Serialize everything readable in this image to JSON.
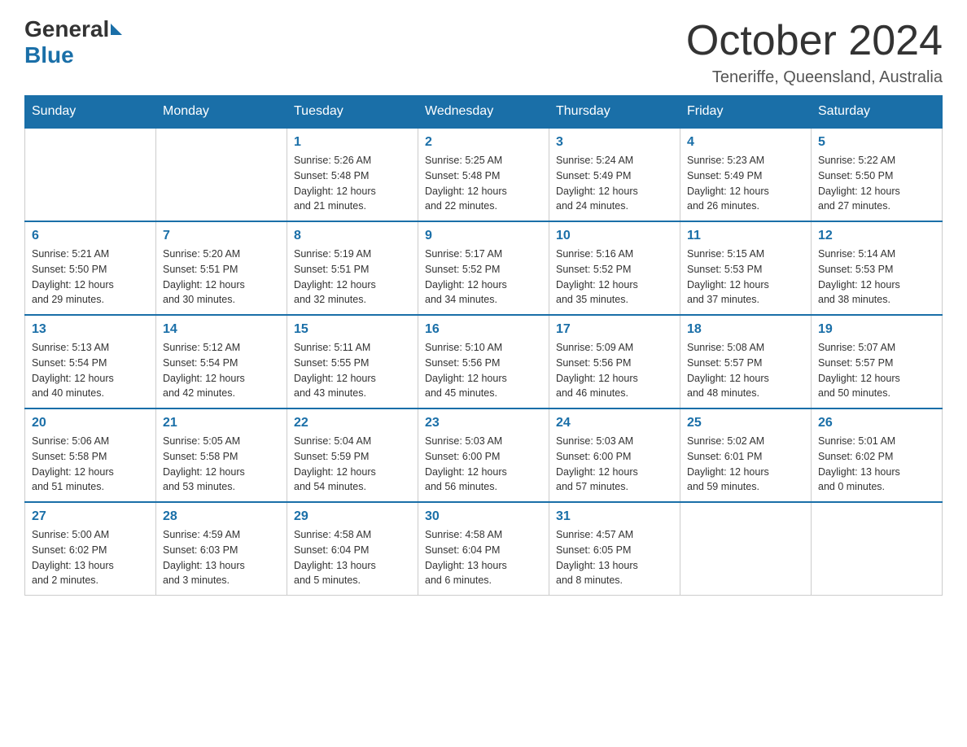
{
  "header": {
    "logo": {
      "general": "General",
      "blue": "Blue"
    },
    "title": "October 2024",
    "location": "Teneriffe, Queensland, Australia"
  },
  "days_of_week": [
    "Sunday",
    "Monday",
    "Tuesday",
    "Wednesday",
    "Thursday",
    "Friday",
    "Saturday"
  ],
  "weeks": [
    [
      {
        "day": "",
        "info": ""
      },
      {
        "day": "",
        "info": ""
      },
      {
        "day": "1",
        "info": "Sunrise: 5:26 AM\nSunset: 5:48 PM\nDaylight: 12 hours\nand 21 minutes."
      },
      {
        "day": "2",
        "info": "Sunrise: 5:25 AM\nSunset: 5:48 PM\nDaylight: 12 hours\nand 22 minutes."
      },
      {
        "day": "3",
        "info": "Sunrise: 5:24 AM\nSunset: 5:49 PM\nDaylight: 12 hours\nand 24 minutes."
      },
      {
        "day": "4",
        "info": "Sunrise: 5:23 AM\nSunset: 5:49 PM\nDaylight: 12 hours\nand 26 minutes."
      },
      {
        "day": "5",
        "info": "Sunrise: 5:22 AM\nSunset: 5:50 PM\nDaylight: 12 hours\nand 27 minutes."
      }
    ],
    [
      {
        "day": "6",
        "info": "Sunrise: 5:21 AM\nSunset: 5:50 PM\nDaylight: 12 hours\nand 29 minutes."
      },
      {
        "day": "7",
        "info": "Sunrise: 5:20 AM\nSunset: 5:51 PM\nDaylight: 12 hours\nand 30 minutes."
      },
      {
        "day": "8",
        "info": "Sunrise: 5:19 AM\nSunset: 5:51 PM\nDaylight: 12 hours\nand 32 minutes."
      },
      {
        "day": "9",
        "info": "Sunrise: 5:17 AM\nSunset: 5:52 PM\nDaylight: 12 hours\nand 34 minutes."
      },
      {
        "day": "10",
        "info": "Sunrise: 5:16 AM\nSunset: 5:52 PM\nDaylight: 12 hours\nand 35 minutes."
      },
      {
        "day": "11",
        "info": "Sunrise: 5:15 AM\nSunset: 5:53 PM\nDaylight: 12 hours\nand 37 minutes."
      },
      {
        "day": "12",
        "info": "Sunrise: 5:14 AM\nSunset: 5:53 PM\nDaylight: 12 hours\nand 38 minutes."
      }
    ],
    [
      {
        "day": "13",
        "info": "Sunrise: 5:13 AM\nSunset: 5:54 PM\nDaylight: 12 hours\nand 40 minutes."
      },
      {
        "day": "14",
        "info": "Sunrise: 5:12 AM\nSunset: 5:54 PM\nDaylight: 12 hours\nand 42 minutes."
      },
      {
        "day": "15",
        "info": "Sunrise: 5:11 AM\nSunset: 5:55 PM\nDaylight: 12 hours\nand 43 minutes."
      },
      {
        "day": "16",
        "info": "Sunrise: 5:10 AM\nSunset: 5:56 PM\nDaylight: 12 hours\nand 45 minutes."
      },
      {
        "day": "17",
        "info": "Sunrise: 5:09 AM\nSunset: 5:56 PM\nDaylight: 12 hours\nand 46 minutes."
      },
      {
        "day": "18",
        "info": "Sunrise: 5:08 AM\nSunset: 5:57 PM\nDaylight: 12 hours\nand 48 minutes."
      },
      {
        "day": "19",
        "info": "Sunrise: 5:07 AM\nSunset: 5:57 PM\nDaylight: 12 hours\nand 50 minutes."
      }
    ],
    [
      {
        "day": "20",
        "info": "Sunrise: 5:06 AM\nSunset: 5:58 PM\nDaylight: 12 hours\nand 51 minutes."
      },
      {
        "day": "21",
        "info": "Sunrise: 5:05 AM\nSunset: 5:58 PM\nDaylight: 12 hours\nand 53 minutes."
      },
      {
        "day": "22",
        "info": "Sunrise: 5:04 AM\nSunset: 5:59 PM\nDaylight: 12 hours\nand 54 minutes."
      },
      {
        "day": "23",
        "info": "Sunrise: 5:03 AM\nSunset: 6:00 PM\nDaylight: 12 hours\nand 56 minutes."
      },
      {
        "day": "24",
        "info": "Sunrise: 5:03 AM\nSunset: 6:00 PM\nDaylight: 12 hours\nand 57 minutes."
      },
      {
        "day": "25",
        "info": "Sunrise: 5:02 AM\nSunset: 6:01 PM\nDaylight: 12 hours\nand 59 minutes."
      },
      {
        "day": "26",
        "info": "Sunrise: 5:01 AM\nSunset: 6:02 PM\nDaylight: 13 hours\nand 0 minutes."
      }
    ],
    [
      {
        "day": "27",
        "info": "Sunrise: 5:00 AM\nSunset: 6:02 PM\nDaylight: 13 hours\nand 2 minutes."
      },
      {
        "day": "28",
        "info": "Sunrise: 4:59 AM\nSunset: 6:03 PM\nDaylight: 13 hours\nand 3 minutes."
      },
      {
        "day": "29",
        "info": "Sunrise: 4:58 AM\nSunset: 6:04 PM\nDaylight: 13 hours\nand 5 minutes."
      },
      {
        "day": "30",
        "info": "Sunrise: 4:58 AM\nSunset: 6:04 PM\nDaylight: 13 hours\nand 6 minutes."
      },
      {
        "day": "31",
        "info": "Sunrise: 4:57 AM\nSunset: 6:05 PM\nDaylight: 13 hours\nand 8 minutes."
      },
      {
        "day": "",
        "info": ""
      },
      {
        "day": "",
        "info": ""
      }
    ]
  ]
}
